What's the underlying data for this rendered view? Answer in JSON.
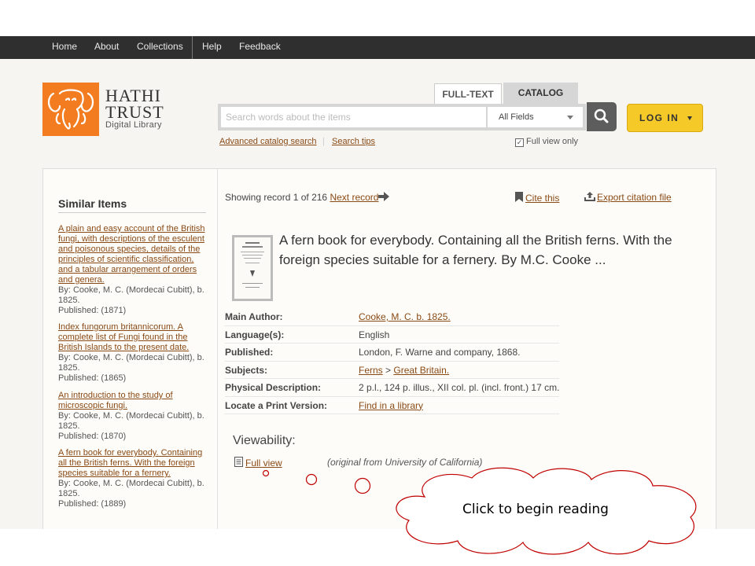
{
  "nav": {
    "home": "Home",
    "about": "About",
    "collections": "Collections",
    "help": "Help",
    "feedback": "Feedback"
  },
  "logo": {
    "line1": "HATHI",
    "line2": "TRUST",
    "line3": "Digital Library"
  },
  "search": {
    "tab_fulltext": "FULL-TEXT",
    "tab_catalog": "CATALOG",
    "placeholder": "Search words about the items",
    "field_selected": "All Fields",
    "advanced": "Advanced catalog search",
    "tips": "Search tips",
    "full_view_only": "Full view only",
    "full_view_only_checked": true
  },
  "login": {
    "label": "LOG IN"
  },
  "sidebar": {
    "heading": "Similar Items",
    "items": [
      {
        "title": "A plain and easy account of the British fungi, with descriptions of the esculent and poisonous species, details of the principles of scientific classification, and a tabular arrangement of orders and genera.",
        "author": "By: Cooke, M. C. (Mordecai Cubitt), b. 1825.",
        "published": "Published: (1871)"
      },
      {
        "title": "Index fungorum britannicorum. A complete list of Fungi found in the British Islands to the present date.",
        "author": "By: Cooke, M. C. (Mordecai Cubitt), b. 1825.",
        "published": "Published: (1865)"
      },
      {
        "title": "An introduction to the study of microscopic fungi.",
        "author": "By: Cooke, M. C. (Mordecai Cubitt), b. 1825.",
        "published": "Published: (1870)"
      },
      {
        "title": "A fern book for everybody. Containing all the British ferns. With the foreign species suitable for a fernery.",
        "author": "By: Cooke, M. C. (Mordecai Cubitt), b. 1825.",
        "published": "Published: (1889)"
      }
    ]
  },
  "record": {
    "showing": "Showing record 1 of 216",
    "next": "Next record",
    "cite": "Cite this",
    "export": "Export citation file",
    "title": "A fern book for everybody. Containing all the British ferns. With the foreign species suitable for a fernery. By M.C. Cooke ...",
    "details": {
      "main_author_label": "Main Author:",
      "main_author": "Cooke, M. C. b. 1825.",
      "language_label": "Language(s):",
      "language": "English",
      "published_label": "Published:",
      "published": "London, F. Warne and company, 1868.",
      "subjects_label": "Subjects:",
      "subject1": "Ferns",
      "subject_sep": ">",
      "subject2": "Great Britain.",
      "physical_label": "Physical Description:",
      "physical": "2 p.l., 124 p. illus., XII col. pl. (incl. front.) 17 cm.",
      "locate_label": "Locate a Print Version:",
      "locate": "Find in a library"
    },
    "viewability_heading": "Viewability:",
    "full_view": "Full view",
    "original_from": "(original from University of California)"
  },
  "callout": {
    "text": "Click to begin reading"
  }
}
